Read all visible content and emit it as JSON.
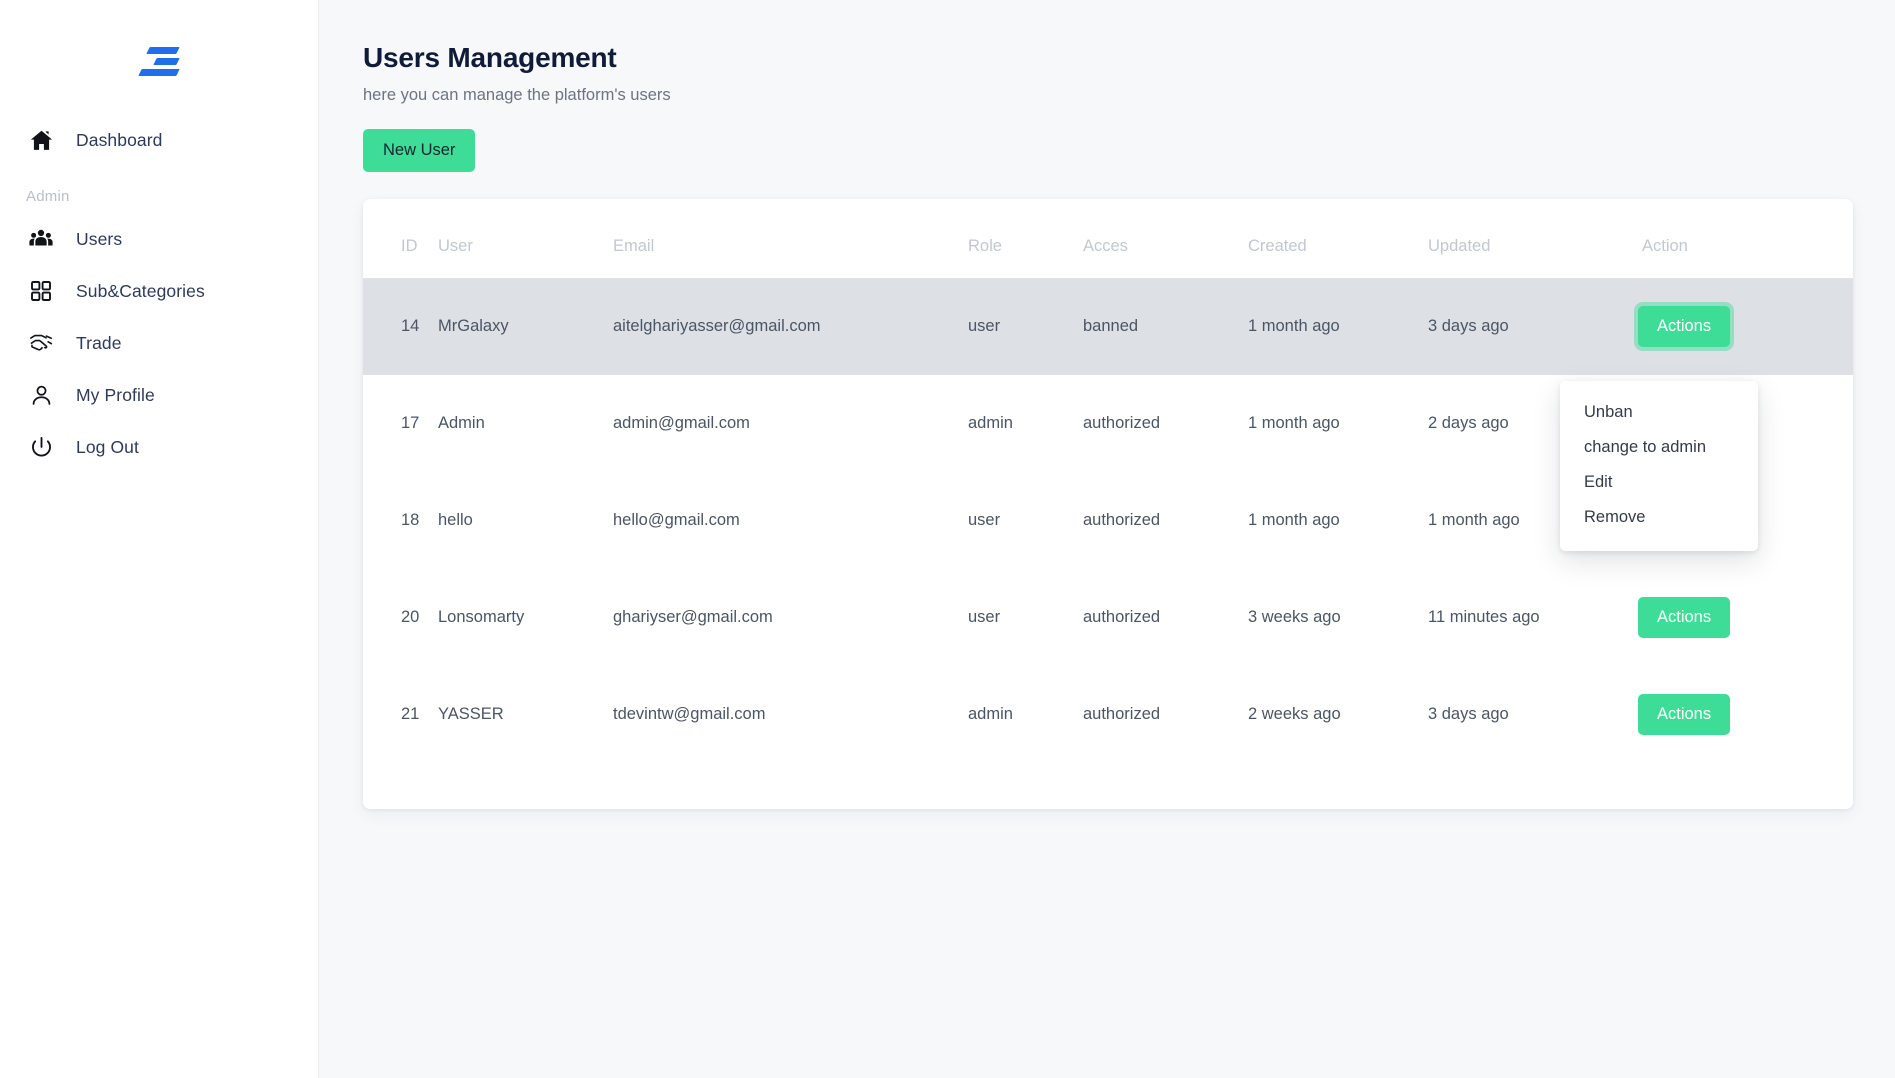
{
  "sidebar": {
    "logo_name": "app-logo",
    "items": [
      {
        "label": "Dashboard",
        "icon": "home-icon"
      }
    ],
    "section_label": "Admin",
    "admin_items": [
      {
        "label": "Users",
        "icon": "users-group-icon"
      },
      {
        "label": "Sub&Categories",
        "icon": "grid-icon"
      },
      {
        "label": "Trade",
        "icon": "handshake-icon"
      },
      {
        "label": "My Profile",
        "icon": "person-icon"
      },
      {
        "label": "Log Out",
        "icon": "power-icon"
      }
    ]
  },
  "page": {
    "title": "Users Management",
    "subtitle": "here you can manage the platform's users",
    "new_user_label": "New User"
  },
  "table": {
    "columns": [
      "ID",
      "User",
      "Email",
      "Role",
      "Acces",
      "Created",
      "Updated",
      "Action"
    ],
    "action_label": "Actions",
    "rows": [
      {
        "id": "14",
        "user": "MrGalaxy",
        "email": "aitelghariyasser@gmail.com",
        "role": "user",
        "acces": "banned",
        "created": "1 month ago",
        "updated": "3 days ago",
        "active": true
      },
      {
        "id": "17",
        "user": "Admin",
        "email": "admin@gmail.com",
        "role": "admin",
        "acces": "authorized",
        "created": "1 month ago",
        "updated": "2 days ago",
        "active": false
      },
      {
        "id": "18",
        "user": "hello",
        "email": "hello@gmail.com",
        "role": "user",
        "acces": "authorized",
        "created": "1 month ago",
        "updated": "1 month ago",
        "active": false
      },
      {
        "id": "20",
        "user": "Lonsomarty",
        "email": "ghariyser@gmail.com",
        "role": "user",
        "acces": "authorized",
        "created": "3 weeks ago",
        "updated": "11 minutes ago",
        "active": false
      },
      {
        "id": "21",
        "user": "YASSER",
        "email": "tdevintw@gmail.com",
        "role": "admin",
        "acces": "authorized",
        "created": "2 weeks ago",
        "updated": "3 days ago",
        "active": false
      }
    ]
  },
  "dropdown": {
    "open_for_row_id": "14",
    "items": [
      "Unban",
      "change to admin",
      "Edit",
      "Remove"
    ]
  },
  "colors": {
    "accent_green": "#3ddc97",
    "logo_blue": "#1f6fed",
    "page_bg": "#f6f8fa",
    "row_highlight": "#dde1e5",
    "title_text": "#101b37"
  }
}
